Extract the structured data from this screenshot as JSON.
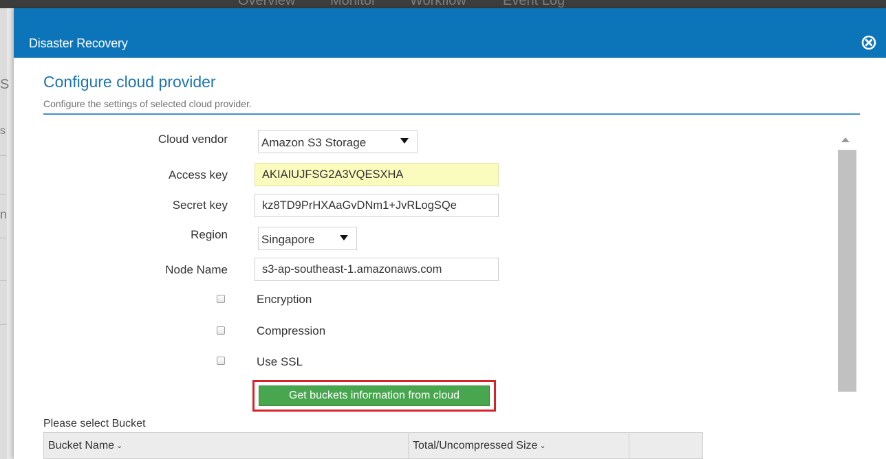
{
  "background_app": {
    "tabs": [
      "Overview",
      "Monitor",
      "Workflow",
      "Event Log"
    ],
    "left_fragments": [
      "S",
      "s",
      "n"
    ]
  },
  "dialog": {
    "title": "Disaster Recovery",
    "close_icon": "close-circle-icon",
    "header_color": "#0c74b8",
    "section_title": "Configure cloud provider",
    "section_subtitle": "Configure the settings of selected cloud provider."
  },
  "form": {
    "cloud_vendor": {
      "label": "Cloud vendor",
      "value": "Amazon S3 Storage"
    },
    "access_key": {
      "label": "Access key",
      "value": "AKIAIUJFSG2A3VQESXHA"
    },
    "secret_key": {
      "label": "Secret key",
      "value": "kz8TD9PrHXAaGvDNm1+JvRLogSQe"
    },
    "region": {
      "label": "Region",
      "value": "Singapore"
    },
    "node_name": {
      "label": "Node Name",
      "value": "s3-ap-southeast-1.amazonaws.com"
    },
    "options": [
      {
        "label": "Encryption",
        "checked": false
      },
      {
        "label": "Compression",
        "checked": false
      },
      {
        "label": "Use SSL",
        "checked": false
      }
    ],
    "get_buckets_button": "Get buckets information from cloud",
    "button_color": "#48a74e",
    "highlight_color": "#d8222a"
  },
  "bucket_section": {
    "label": "Please select Bucket",
    "columns": [
      "Bucket Name",
      "Total/Uncompressed Size"
    ],
    "sort_icon": "chevron-down-icon"
  }
}
